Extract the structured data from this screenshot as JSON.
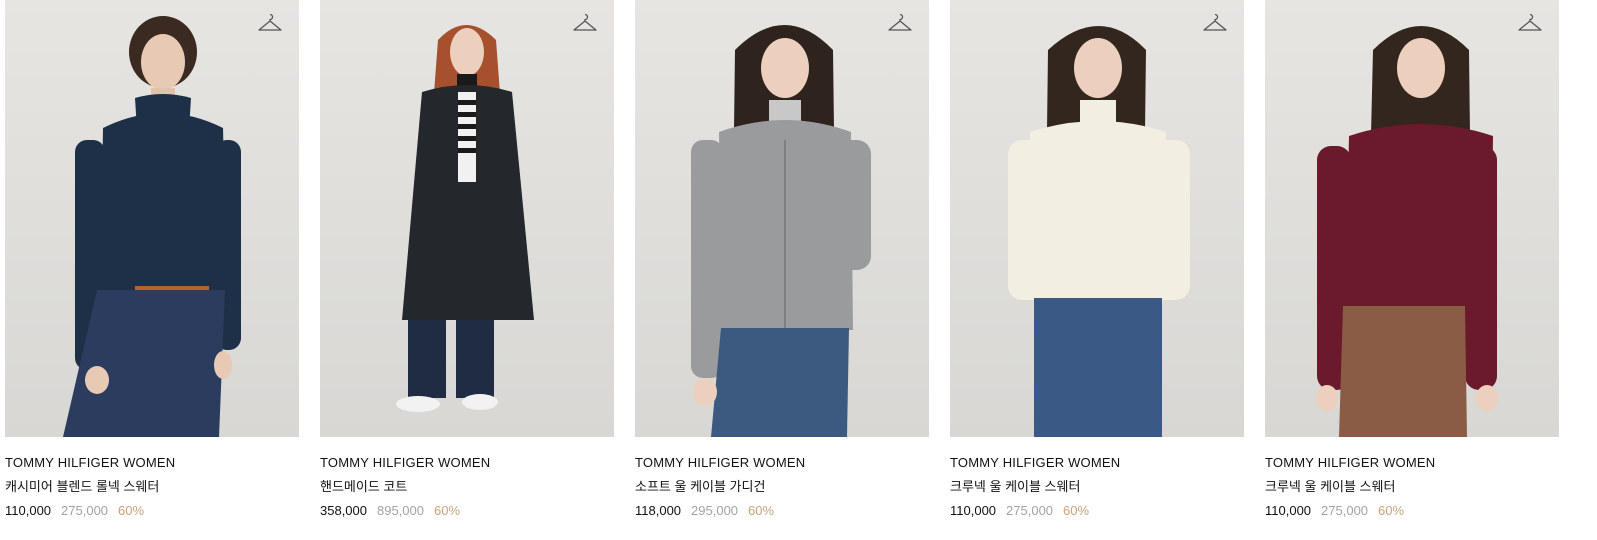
{
  "products": [
    {
      "brand": "TOMMY HILFIGER WOMEN",
      "name": "캐시미어 블렌드 롤넥 스웨터",
      "price": "110,000",
      "original_price": "275,000",
      "discount": "60%",
      "top_color": "#1e2f48",
      "bottom_color": "#2b3c5e",
      "hair_color": "#3a2a22"
    },
    {
      "brand": "TOMMY HILFIGER WOMEN",
      "name": "핸드메이드 코트",
      "price": "358,000",
      "original_price": "895,000",
      "discount": "60%",
      "top_color": "#24272b",
      "bottom_color": "#1f2c44",
      "hair_color": "#a6502e"
    },
    {
      "brand": "TOMMY HILFIGER WOMEN",
      "name": "소프트 울 케이블 가디건",
      "price": "118,000",
      "original_price": "295,000",
      "discount": "60%",
      "top_color": "#9a9b9d",
      "bottom_color": "#3c5a80",
      "hair_color": "#2e231d"
    },
    {
      "brand": "TOMMY HILFIGER WOMEN",
      "name": "크루넥 울 케이블 스웨터",
      "price": "110,000",
      "original_price": "275,000",
      "discount": "60%",
      "top_color": "#f2eee2",
      "bottom_color": "#3a5a85",
      "hair_color": "#33261e"
    },
    {
      "brand": "TOMMY HILFIGER WOMEN",
      "name": "크루넥 울 케이블 스웨터",
      "price": "110,000",
      "original_price": "275,000",
      "discount": "60%",
      "top_color": "#6b1a2b",
      "bottom_color": "#8a5c46",
      "hair_color": "#33261e"
    }
  ],
  "icons": {
    "wishlist": "hanger-icon"
  }
}
